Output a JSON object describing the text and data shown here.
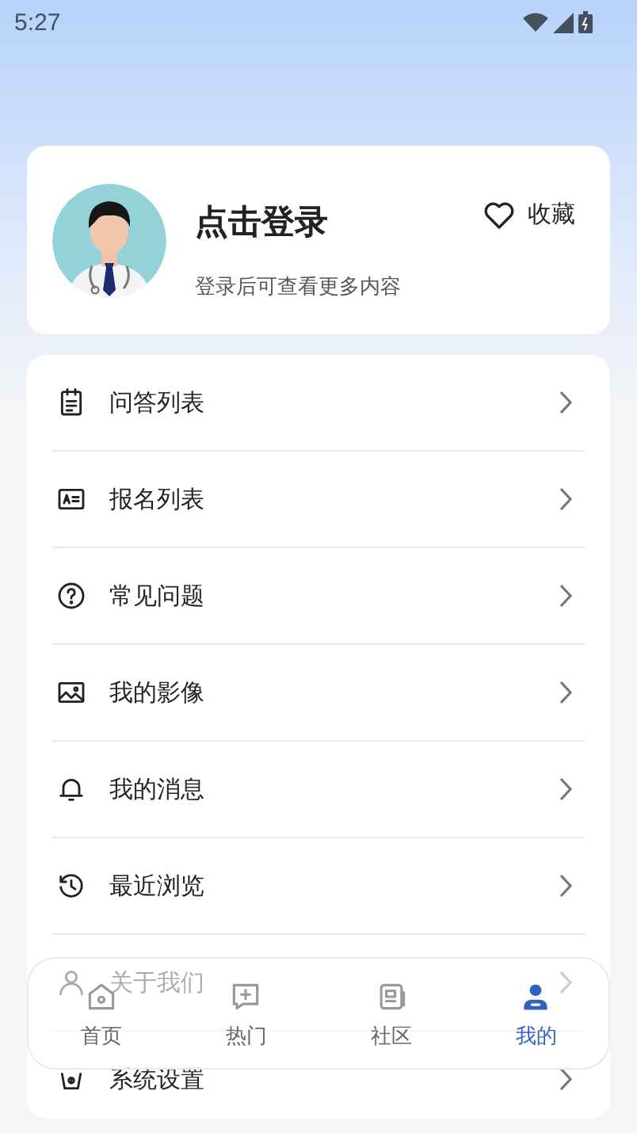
{
  "status_bar": {
    "time": "5:27"
  },
  "profile": {
    "title": "点击登录",
    "subtitle": "登录后可查看更多内容",
    "favorite": "收藏"
  },
  "menu": [
    {
      "label": "问答列表"
    },
    {
      "label": "报名列表"
    },
    {
      "label": "常见问题"
    },
    {
      "label": "我的影像"
    },
    {
      "label": "我的消息"
    },
    {
      "label": "最近浏览"
    },
    {
      "label": "关于我们"
    },
    {
      "label": "系统设置"
    }
  ],
  "tabs": [
    {
      "label": "首页",
      "selected": false
    },
    {
      "label": "热门",
      "selected": false
    },
    {
      "label": "社区",
      "selected": false
    },
    {
      "label": "我的",
      "selected": true
    }
  ]
}
